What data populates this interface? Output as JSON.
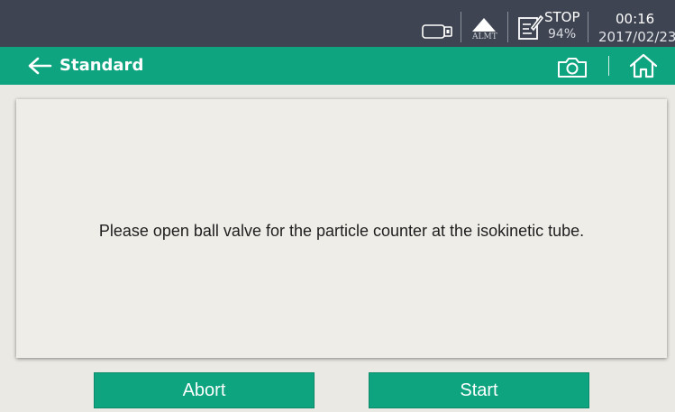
{
  "status_bar": {
    "usb_icon": "usb-drive-icon",
    "alarm_icon": "alarm-triangle-icon",
    "alarm_label": "ALMT",
    "log_icon": "log-edit-icon",
    "state": "STOP",
    "battery": "94%",
    "time": "00:16",
    "date": "2017/02/23"
  },
  "title_bar": {
    "title": "Standard",
    "back_icon": "back-arrow-icon",
    "camera_icon": "camera-icon",
    "home_icon": "home-icon"
  },
  "message": "Please open ball valve for the particle counter at the isokinetic tube.",
  "buttons": {
    "abort": "Abort",
    "start": "Start"
  },
  "colors": {
    "status_bar_bg": "#3e4451",
    "accent": "#0ea47f",
    "background": "#ebe9e4",
    "panel_bg": "#efede8"
  }
}
